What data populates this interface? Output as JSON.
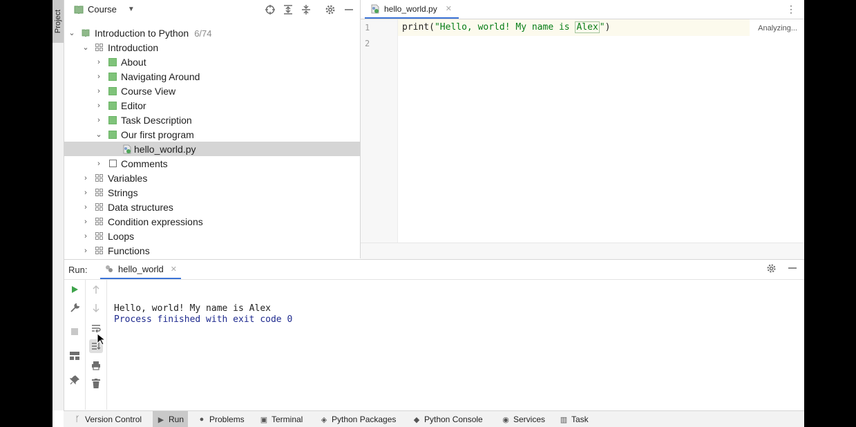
{
  "left_strip": {
    "project_tab": "Project"
  },
  "project_panel": {
    "view_selector": "Course",
    "tree": {
      "root": {
        "label": "Introduction to Python",
        "count": "6/74"
      },
      "section": "Introduction",
      "lessons": [
        {
          "label": "About",
          "state": "solved"
        },
        {
          "label": "Navigating Around",
          "state": "solved"
        },
        {
          "label": "Course View",
          "state": "solved"
        },
        {
          "label": "Editor",
          "state": "solved"
        },
        {
          "label": "Task Description",
          "state": "solved"
        },
        {
          "label": "Our first program",
          "state": "solved-expanded"
        }
      ],
      "file": "hello_world.py",
      "after_file": {
        "label": "Comments",
        "state": "unsolved"
      },
      "sections": [
        "Variables",
        "Strings",
        "Data structures",
        "Condition expressions",
        "Loops",
        "Functions"
      ]
    }
  },
  "editor": {
    "tab_label": "hello_world.py",
    "line_numbers": [
      "1",
      "2"
    ],
    "code": {
      "fn": "print(",
      "str_open": "\"Hello, world! My name is ",
      "highlighted": "Alex",
      "str_close": "\"",
      "paren_close": ")"
    },
    "status": "Analyzing..."
  },
  "run_panel": {
    "title": "Run:",
    "tab_label": "hello_world",
    "output_line": "Hello, world! My name is Alex",
    "process_line": "Process finished with exit code 0"
  },
  "bottom_bar": {
    "items": [
      {
        "label": "Version Control",
        "icon": "branch-icon"
      },
      {
        "label": "Run",
        "icon": "play-icon",
        "active": true
      },
      {
        "label": "Problems",
        "icon": "problems-icon"
      },
      {
        "label": "Terminal",
        "icon": "terminal-icon"
      },
      {
        "label": "Python Packages",
        "icon": "packages-icon"
      },
      {
        "label": "Python Console",
        "icon": "python-icon"
      },
      {
        "label": "Services",
        "icon": "services-icon"
      },
      {
        "label": "Task",
        "icon": "book-icon"
      }
    ]
  },
  "colors": {
    "accent": "#3b73d6",
    "solved_green": "#7fc37a",
    "string_green": "#067d17",
    "console_blue": "#1e2a8e",
    "run_green": "#3ea34b"
  }
}
